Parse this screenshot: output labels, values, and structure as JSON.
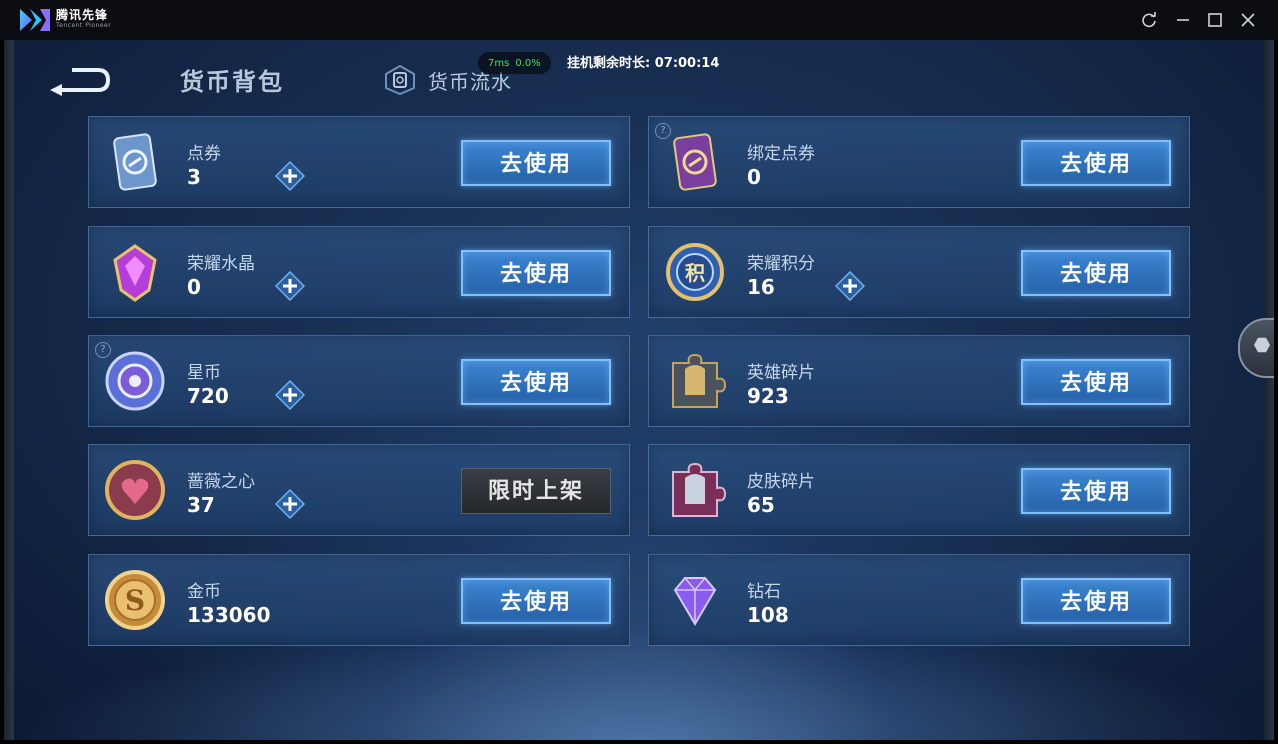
{
  "window": {
    "brand_cn": "腾讯先锋",
    "brand_en": "Tencent Pioneer",
    "controls": [
      "refresh-icon",
      "minimize-icon",
      "maximize-icon",
      "close-icon"
    ]
  },
  "header": {
    "title": "货币背包",
    "tab_flow": "货币流水",
    "latency_ms": "7ms",
    "loss": "0.0%",
    "idle_time": "挂机剩余时长: 07:00:14"
  },
  "currencies": [
    {
      "name": "点券",
      "amount": "3",
      "button": "去使用",
      "plus": true,
      "help": false,
      "icon": "coupon-card-icon"
    },
    {
      "name": "绑定点券",
      "amount": "0",
      "button": "去使用",
      "plus": false,
      "help": true,
      "icon": "bound-coupon-card-icon"
    },
    {
      "name": "荣耀水晶",
      "amount": "0",
      "button": "去使用",
      "plus": true,
      "help": false,
      "icon": "glory-crystal-icon"
    },
    {
      "name": "荣耀积分",
      "amount": "16",
      "button": "去使用",
      "plus": true,
      "help": false,
      "icon": "glory-points-icon"
    },
    {
      "name": "星币",
      "amount": "720",
      "button": "去使用",
      "plus": true,
      "help": true,
      "icon": "star-coin-icon"
    },
    {
      "name": "英雄碎片",
      "amount": "923",
      "button": "去使用",
      "plus": false,
      "help": false,
      "icon": "hero-fragment-icon"
    },
    {
      "name": "蔷薇之心",
      "amount": "37",
      "button": "限时上架",
      "plus": true,
      "help": false,
      "icon": "rose-heart-icon"
    },
    {
      "name": "皮肤碎片",
      "amount": "65",
      "button": "去使用",
      "plus": false,
      "help": false,
      "icon": "skin-fragment-icon"
    },
    {
      "name": "金币",
      "amount": "133060",
      "button": "去使用",
      "plus": false,
      "help": false,
      "icon": "gold-coin-icon"
    },
    {
      "name": "钻石",
      "amount": "108",
      "button": "去使用",
      "plus": false,
      "help": false,
      "icon": "diamond-icon"
    }
  ],
  "help_mark": "?"
}
